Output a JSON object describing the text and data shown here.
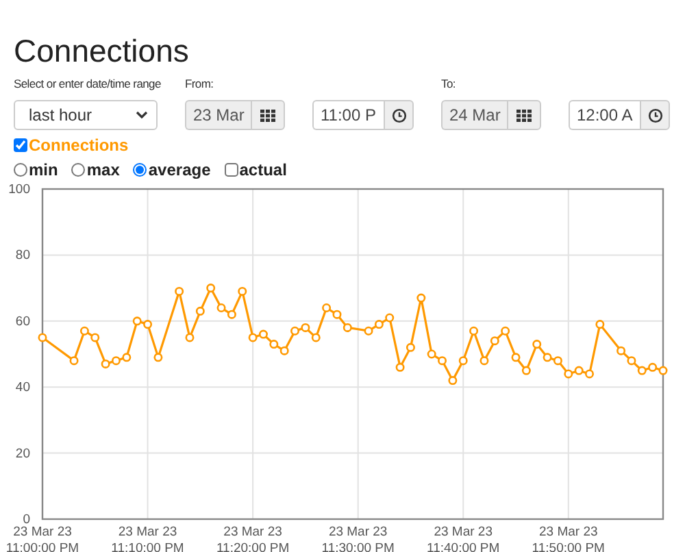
{
  "title": "Connections",
  "range": {
    "label": "Select or enter date/time range",
    "value": "last hour"
  },
  "from": {
    "label": "From:",
    "date": "23 Mar",
    "date_disabled": true,
    "time": "11:00 P"
  },
  "to": {
    "label": "To:",
    "date": "24 Mar",
    "date_disabled": true,
    "time": "12:00 A"
  },
  "series_toggle": {
    "checked": true
  },
  "aggregates": [
    {
      "label": "min",
      "selected": false
    },
    {
      "label": "max",
      "selected": false
    },
    {
      "label": "average",
      "selected": true
    }
  ],
  "actual": {
    "label": "actual",
    "checked": false
  },
  "chart": {
    "chart_data": {
      "type": "line",
      "categories": [
        "23 Mar 23 11:00:00 PM",
        null,
        null,
        null,
        null,
        null,
        null,
        null,
        null,
        null,
        "23 Mar 23 11:10:00 PM",
        null,
        null,
        null,
        null,
        null,
        null,
        null,
        null,
        null,
        "23 Mar 23 11:20:00 PM",
        null,
        null,
        null,
        null,
        null,
        null,
        null,
        null,
        null,
        "23 Mar 23 11:30:00 PM",
        null,
        null,
        null,
        null,
        null,
        null,
        null,
        null,
        null,
        "23 Mar 23 11:40:00 PM",
        null,
        null,
        null,
        null,
        null,
        null,
        null,
        null,
        null,
        "23 Mar 23 11:50:00 PM",
        null,
        null,
        null,
        null,
        null,
        null,
        null,
        null,
        null
      ],
      "grid": true,
      "series": [
        {
          "name": "Connections",
          "color": "#ff9900",
          "marker": "circle",
          "values": [
            55,
            null,
            null,
            48,
            57,
            55,
            47,
            48,
            49,
            60,
            59,
            49,
            null,
            69,
            55,
            63,
            70,
            64,
            62,
            69,
            55,
            56,
            53,
            51,
            57,
            58,
            55,
            64,
            62,
            58,
            null,
            57,
            59,
            61,
            46,
            52,
            67,
            50,
            48,
            42,
            48,
            57,
            48,
            54,
            57,
            49,
            45,
            53,
            49,
            48,
            44,
            45,
            44,
            59,
            null,
            51,
            48,
            45,
            46,
            45
          ]
        }
      ],
      "ylim": [
        0,
        100
      ],
      "yticks": [
        0,
        20,
        40,
        60,
        80,
        100
      ]
    }
  }
}
